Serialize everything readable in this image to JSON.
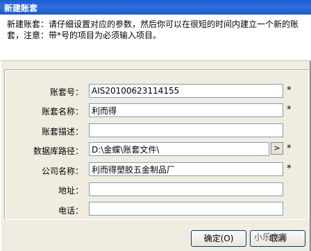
{
  "window": {
    "title": "新建账套"
  },
  "description": "新建账套：请仔细设置对应的参数，然后你可以在很短的时间内建立一个新的账套，注意：带*号的项目为必须输入项目。",
  "form": {
    "code_label": "账套号：",
    "code_value": "AIS20100623114155",
    "name_label": "账套名称：",
    "name_value": "利而得",
    "desc_label": "账套描述：",
    "desc_value": "",
    "dbpath_label": "数据库路径：",
    "dbpath_value": "D:\\金蝶\\账套文件\\",
    "company_label": "公司名称：",
    "company_value": "利而得塑胶五金制品厂",
    "address_label": "地址：",
    "address_value": "",
    "phone_label": "电话：",
    "phone_value": "",
    "required_mark": "*",
    "browse_label": ">"
  },
  "buttons": {
    "ok_label": "确定(O)",
    "cancel_label": "取消"
  },
  "watermark": "小乐电商"
}
